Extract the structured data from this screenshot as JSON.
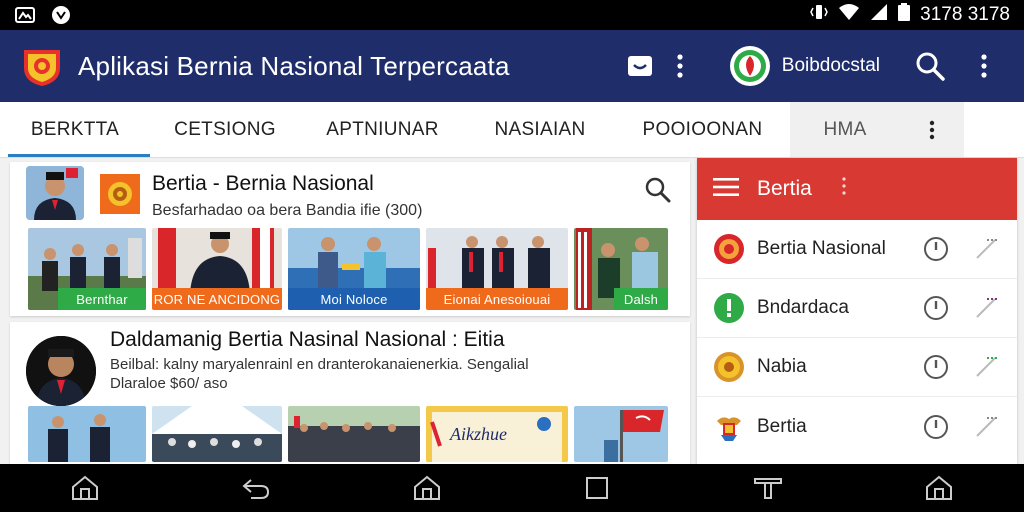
{
  "status_bar": {
    "time": "3178 3178",
    "icons": [
      "notification-icon",
      "app-icon",
      "vibrate-icon",
      "wifi-icon",
      "signal-icon",
      "battery-icon"
    ]
  },
  "app_bar": {
    "title": "Aplikasi Bernia Nasional Terpercaata",
    "account_name": "Boibdocstal",
    "icons": [
      "logo-icon",
      "message-icon",
      "more-vert-icon",
      "account-avatar",
      "search-icon",
      "overflow-icon"
    ],
    "bg_color": "#1f2d6b"
  },
  "tabs": [
    {
      "label": "BERKTTA",
      "active": true
    },
    {
      "label": "CETSIONG",
      "active": false
    },
    {
      "label": "APTNIUNAR",
      "active": false
    },
    {
      "label": "NASIAIAN",
      "active": false
    },
    {
      "label": "POOIOONAN",
      "active": false
    },
    {
      "label": "HMA",
      "active": false
    }
  ],
  "card1": {
    "title": "Bertia - Bernia Nasional",
    "subtitle": "Besfarhadao oa bera Bandia ifie (300)",
    "photos": [
      {
        "label": "Bernthar",
        "label_color": "#2eaa46"
      },
      {
        "label": "ROR NE ANCIDONG",
        "label_color": "#f06a1c"
      },
      {
        "label": "Moi Noloce",
        "label_color": "#1f5fb0"
      },
      {
        "label": "Eionai Anesoiouai",
        "label_color": "#f06a1c"
      },
      {
        "label": "Dalsh",
        "label_color": "#2eaa46"
      }
    ]
  },
  "card2": {
    "title": "Daldamanig Bertia Nasinal Nasional : Eitia",
    "line1": "Beilbal: kalny maryalenrainl en dranterokanaienerkia. Sengalial",
    "line2": "Dlaraloe $60/ aso",
    "photos": [
      {
        "label": ""
      },
      {
        "label": ""
      },
      {
        "label": ""
      },
      {
        "label": "Aikzhue"
      },
      {
        "label": ""
      }
    ]
  },
  "panel": {
    "title": "Bertia",
    "header_color": "#d83a33",
    "items": [
      {
        "label": "Bertia Nasional",
        "icon": "emblem-red-icon"
      },
      {
        "label": "Bndardaca",
        "icon": "info-green-icon"
      },
      {
        "label": "Nabia",
        "icon": "emblem-gold-icon"
      },
      {
        "label": "Bertia",
        "icon": "garuda-icon"
      }
    ]
  },
  "nav_bar": {
    "icons": [
      "home-icon",
      "back-icon",
      "home-icon",
      "recents-icon",
      "menu-icon",
      "home-outline-icon"
    ]
  }
}
